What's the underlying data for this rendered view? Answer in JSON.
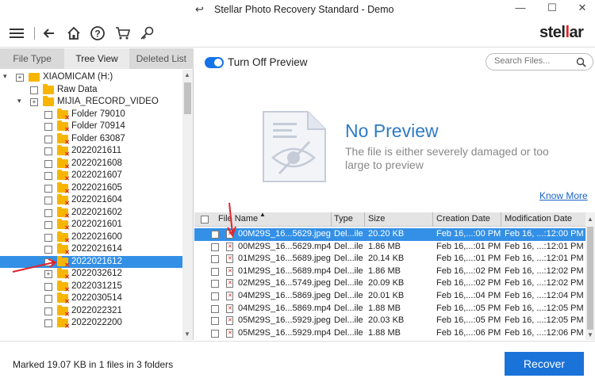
{
  "window": {
    "title": "Stellar Photo Recovery Standard - Demo",
    "title_icon": "restore-icon"
  },
  "toolbar": {
    "logo_pre": "stel",
    "logo_mid": "l",
    "logo_post": "ar"
  },
  "tabs": [
    {
      "label": "File Type"
    },
    {
      "label": "Tree View"
    },
    {
      "label": "Deleted List"
    }
  ],
  "tree": [
    {
      "label": "XIAOMICAM (H:)",
      "expander": "▾",
      "check": "+"
    },
    {
      "label": "Raw Data",
      "expander": "",
      "check": ""
    },
    {
      "label": "MIJIA_RECORD_VIDEO",
      "expander": "▾",
      "check": "+"
    },
    {
      "label": "Folder 79010",
      "expander": "",
      "check": ""
    },
    {
      "label": "Folder 70914",
      "expander": "",
      "check": ""
    },
    {
      "label": "Folder 63087",
      "expander": "",
      "check": ""
    },
    {
      "label": "2022021611",
      "expander": "",
      "check": ""
    },
    {
      "label": "2022021608",
      "expander": "",
      "check": ""
    },
    {
      "label": "2022021607",
      "expander": "",
      "check": ""
    },
    {
      "label": "2022021605",
      "expander": "",
      "check": ""
    },
    {
      "label": "2022021604",
      "expander": "",
      "check": ""
    },
    {
      "label": "2022021602",
      "expander": "",
      "check": ""
    },
    {
      "label": "2022021601",
      "expander": "",
      "check": ""
    },
    {
      "label": "2022021600",
      "expander": "",
      "check": ""
    },
    {
      "label": "2022021614",
      "expander": "",
      "check": ""
    },
    {
      "label": "2022021612",
      "expander": "",
      "check": "",
      "selected": true
    },
    {
      "label": "2022032612",
      "expander": "",
      "check": "+"
    },
    {
      "label": "2022031215",
      "expander": "",
      "check": ""
    },
    {
      "label": "2022030514",
      "expander": "",
      "check": ""
    },
    {
      "label": "2022022321",
      "expander": "",
      "check": ""
    },
    {
      "label": "2022022200",
      "expander": "",
      "check": ""
    }
  ],
  "preview": {
    "toggle_label": "Turn Off Preview",
    "no_preview_title": "No Preview",
    "no_preview_desc": "The file is either severely damaged or too large to preview",
    "know_more": "Know More"
  },
  "search": {
    "placeholder": "Search Files..."
  },
  "table": {
    "columns": [
      "File Name",
      "Type",
      "Size",
      "Creation Date",
      "Modification Date"
    ],
    "rows": [
      {
        "name": "00M29S_16...5629.jpeg",
        "type": "Del...ile",
        "size": "20.20 KB",
        "created": "Feb 16,...:00 PM",
        "modified": "Feb 16, ...:12:00 PM",
        "selected": true
      },
      {
        "name": "00M29S_16...5629.mp4",
        "type": "Del...ile",
        "size": "1.86 MB",
        "created": "Feb 16,...:01 PM",
        "modified": "Feb 16, ...:12:01 PM"
      },
      {
        "name": "01M29S_16...5689.jpeg",
        "type": "Del...ile",
        "size": "20.14 KB",
        "created": "Feb 16,...:01 PM",
        "modified": "Feb 16, ...:12:01 PM"
      },
      {
        "name": "01M29S_16...5689.mp4",
        "type": "Del...ile",
        "size": "1.86 MB",
        "created": "Feb 16,...:02 PM",
        "modified": "Feb 16, ...:12:02 PM"
      },
      {
        "name": "02M29S_16...5749.jpeg",
        "type": "Del...ile",
        "size": "20.09 KB",
        "created": "Feb 16,...:02 PM",
        "modified": "Feb 16, ...:12:02 PM"
      },
      {
        "name": "04M29S_16...5869.jpeg",
        "type": "Del...ile",
        "size": "20.01 KB",
        "created": "Feb 16,...:04 PM",
        "modified": "Feb 16, ...:12:04 PM"
      },
      {
        "name": "04M29S_16...5869.mp4",
        "type": "Del...ile",
        "size": "1.88 MB",
        "created": "Feb 16,...:05 PM",
        "modified": "Feb 16, ...:12:05 PM"
      },
      {
        "name": "05M29S_16...5929.jpeg",
        "type": "Del...ile",
        "size": "20.03 KB",
        "created": "Feb 16,...:05 PM",
        "modified": "Feb 16, ...:12:05 PM"
      },
      {
        "name": "05M29S_16...5929.mp4",
        "type": "Del...ile",
        "size": "1.88 MB",
        "created": "Feb 16,...:06 PM",
        "modified": "Feb 16, ...:12:06 PM"
      }
    ]
  },
  "status": {
    "text": "Marked 19.07 KB in 1 files in 3 folders"
  },
  "recover": {
    "label": "Recover"
  },
  "colors": {
    "accent": "#1a73d9",
    "selection": "#3390e6",
    "folder": "#f7b500",
    "annotation": "#e3232b"
  }
}
